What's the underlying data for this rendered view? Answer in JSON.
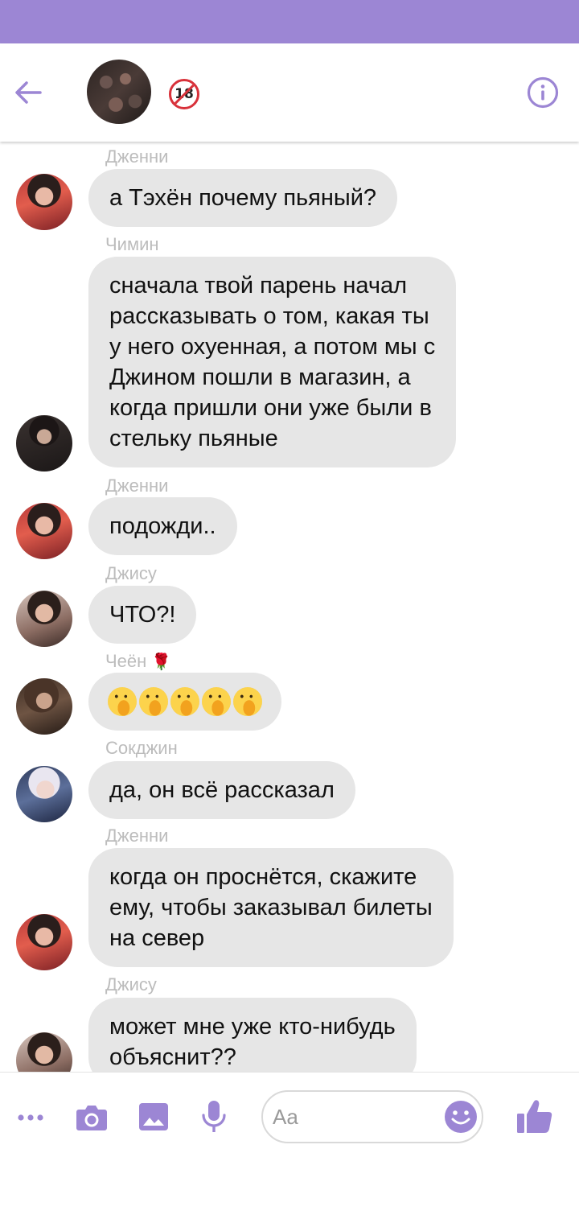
{
  "header": {
    "age_badge": "18",
    "back_icon": "arrow-left-icon",
    "info_icon": "info-icon"
  },
  "colors": {
    "accent": "#9c86d4",
    "bubble": "#e6e6e6",
    "sender_text": "#bcbcbc"
  },
  "messages": [
    {
      "sender": "Дженни",
      "avatar": "jennie",
      "text": "а Тэхён почему пьяный?"
    },
    {
      "sender": "Чимин",
      "avatar": "jimin",
      "lines": [
        "сначала твой парень начал",
        "рассказывать о том, какая ты",
        "у него охуенная, а потом мы с",
        "Джином пошли в магазин, а",
        "когда пришли они уже были в",
        "стельку пьяные"
      ]
    },
    {
      "sender": "Дженни",
      "avatar": "jennie",
      "text": "подожди.."
    },
    {
      "sender": "Джису",
      "avatar": "jisoo",
      "text": "ЧТО?!"
    },
    {
      "sender": "Чеён",
      "sender_emoji": "🌹",
      "avatar": "chaeyoung",
      "emoji_count": 5,
      "emoji_name": "face-with-hand-over-mouth"
    },
    {
      "sender": "Сокджин",
      "avatar": "jin",
      "text": "да, он всё рассказал"
    },
    {
      "sender": "Дженни",
      "avatar": "jennie",
      "lines": [
        "когда он проснётся, скажите",
        "ему, чтобы заказывал билеты",
        "на север"
      ]
    },
    {
      "sender": "Джису",
      "avatar": "jisoo",
      "lines": [
        "может мне уже кто-нибудь",
        "объяснит??"
      ]
    }
  ],
  "composer": {
    "placeholder": "Aa",
    "icons": [
      "more-icon",
      "camera-icon",
      "image-icon",
      "microphone-icon",
      "smiley-icon",
      "thumbs-up-icon"
    ]
  }
}
